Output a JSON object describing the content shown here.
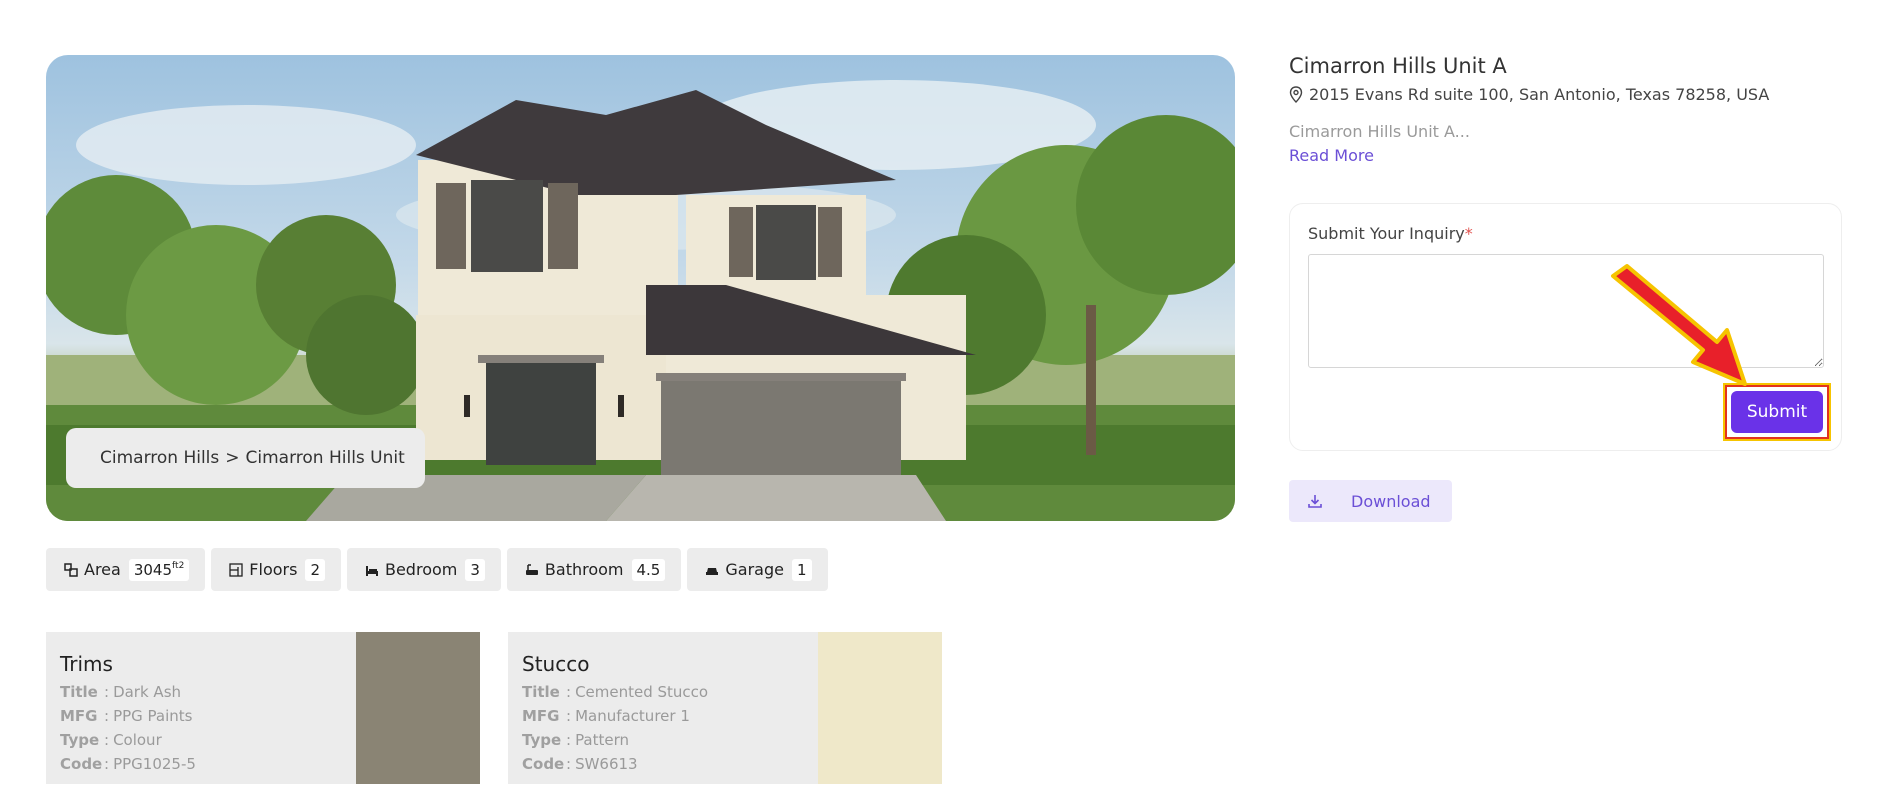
{
  "hero": {
    "breadcrumb_parent": "Cimarron Hills",
    "breadcrumb_sep": ">",
    "breadcrumb_current": "Cimarron Hills Unit"
  },
  "features": [
    {
      "label": "Area",
      "value": "3045",
      "unit": "ft",
      "unit_sup": "2"
    },
    {
      "label": "Floors",
      "value": "2"
    },
    {
      "label": "Bedroom",
      "value": "3"
    },
    {
      "label": "Bathroom",
      "value": "4.5"
    },
    {
      "label": "Garage",
      "value": "1"
    }
  ],
  "materials": [
    {
      "name": "Trims",
      "rows": [
        {
          "key": "Title",
          "value": "Dark Ash"
        },
        {
          "key": "MFG",
          "value": "PPG Paints"
        },
        {
          "key": "Type",
          "value": "Colour"
        },
        {
          "key": "Code",
          "value": "PPG1025-5"
        }
      ],
      "swatch_color": "#8a8474"
    },
    {
      "name": "Stucco",
      "rows": [
        {
          "key": "Title",
          "value": "Cemented Stucco"
        },
        {
          "key": "MFG",
          "value": "Manufacturer 1"
        },
        {
          "key": "Type",
          "value": "Pattern"
        },
        {
          "key": "Code",
          "value": "SW6613"
        }
      ],
      "swatch_color": "#efe8c9"
    }
  ],
  "property": {
    "title": "Cimarron Hills Unit A",
    "address": "2015 Evans Rd suite 100, San Antonio, Texas 78258, USA",
    "description": "Cimarron Hills Unit A...",
    "read_more": "Read More"
  },
  "inquiry": {
    "label": "Submit Your Inquiry",
    "required_mark": "*",
    "submit_label": "Submit"
  },
  "download_label": "Download",
  "colors": {
    "accent": "#6a32e8",
    "link": "#6b4fd6",
    "annotation_arrow": "#e8202a",
    "annotation_outline": "#f6c400"
  }
}
